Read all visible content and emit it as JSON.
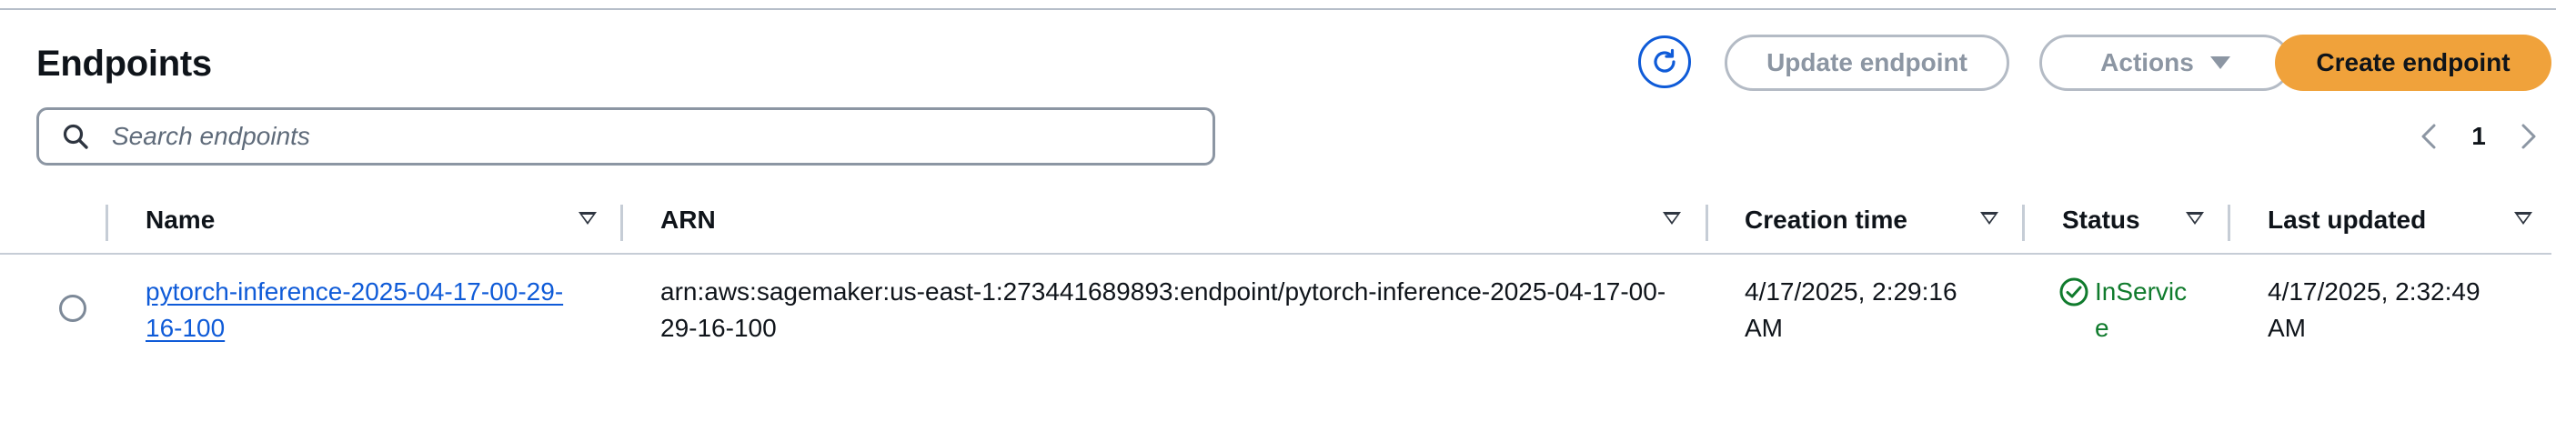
{
  "page": {
    "title": "Endpoints"
  },
  "header_actions": {
    "refresh_icon": "refresh-icon",
    "update_label": "Update endpoint",
    "actions_label": "Actions",
    "create_label": "Create endpoint"
  },
  "search": {
    "placeholder": "Search endpoints",
    "value": ""
  },
  "pagination": {
    "current_page": "1"
  },
  "table": {
    "columns": [
      {
        "label": "Name"
      },
      {
        "label": "ARN"
      },
      {
        "label": "Creation time"
      },
      {
        "label": "Status"
      },
      {
        "label": "Last updated"
      }
    ],
    "rows": [
      {
        "name": "pytorch-inference-2025-04-17-00-29-16-100",
        "arn": "arn:aws:sagemaker:us-east-1:273441689893:endpoint/pytorch-inference-2025-04-17-00-29-16-100",
        "creation_time": "4/17/2025, 2:29:16 AM",
        "status": "InService",
        "last_updated": "4/17/2025, 2:32:49 AM"
      }
    ]
  },
  "colors": {
    "primary": "#f0a23b",
    "link": "#0f5bd8",
    "success": "#107b2d",
    "disabled": "#8c96a3"
  }
}
